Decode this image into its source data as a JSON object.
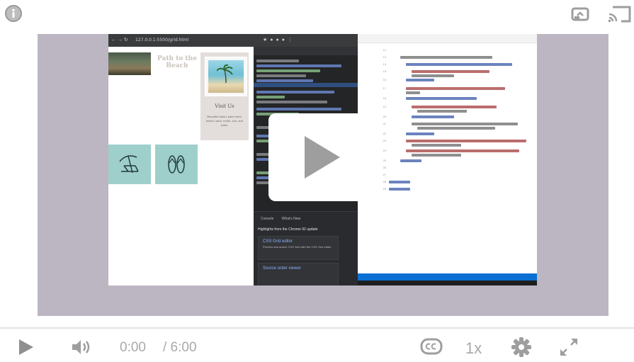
{
  "player": {
    "icons": {
      "info": "info-icon",
      "cast": "cast-icon",
      "screen": "screen-share-icon",
      "play_big": "play-icon",
      "play_small": "play-icon",
      "volume": "volume-icon",
      "captions": "closed-captions-icon",
      "settings": "gear-icon",
      "fullscreen": "fullscreen-icon"
    },
    "time_current": "0:00",
    "time_total": "/ 6:00",
    "speed_label": "1x",
    "progress": 0,
    "colors": {
      "stage_background": "#bcb6c3",
      "controls_icon": "#9e9e9e"
    }
  },
  "video_frame": {
    "browser": {
      "url": "127.0.0.1:5500/grid.html",
      "page_title": "Path to the Beach",
      "card_heading": "Visit Us",
      "card_description": "Beautiful island, palm trees, beach, sand, exotic, sea, and water."
    },
    "devtools": {
      "tab_console": "Console",
      "tab_whats_new": "What's New",
      "highlights": "Highlights from the Chrome 92 update",
      "card1_title": "CSS Grid editor",
      "card1_text": "Preview and author CSS Grid with the CSS Grid editor.",
      "card2_title": "Source order viewer"
    },
    "editor": {
      "line_numbers": [
        "12",
        "13",
        "14",
        "15",
        "16",
        "17",
        "18",
        "19",
        "20",
        "21",
        "22",
        "23",
        "24",
        "25",
        "26",
        "27",
        "28",
        "29"
      ]
    }
  }
}
